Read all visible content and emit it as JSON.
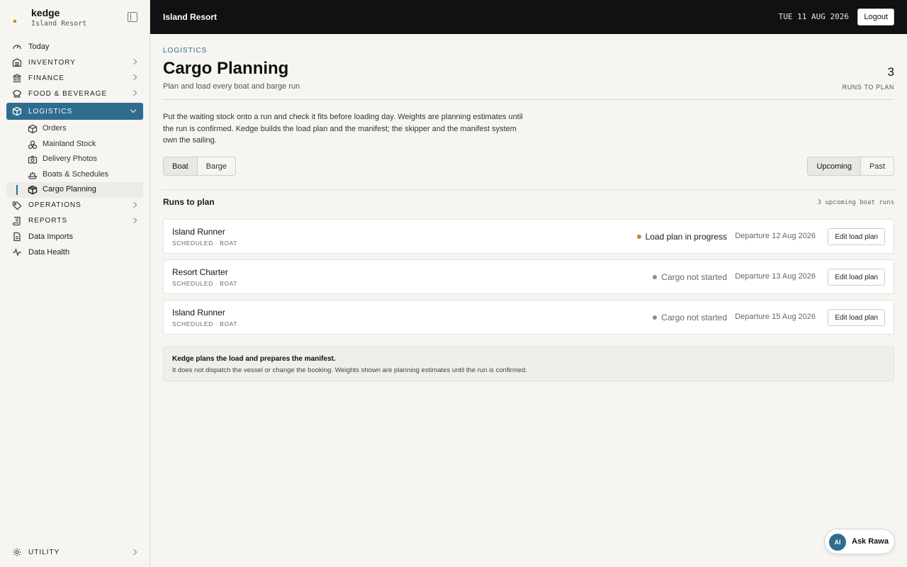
{
  "brand": {
    "name": "kedge",
    "property": "Island Resort"
  },
  "sidebar": {
    "items": [
      {
        "label": "Today",
        "icon": "gauge-icon"
      },
      {
        "label": "INVENTORY",
        "icon": "warehouse-icon"
      },
      {
        "label": "FINANCE",
        "icon": "bank-icon"
      },
      {
        "label": "FOOD & BEVERAGE",
        "icon": "chef-hat-icon"
      },
      {
        "label": "LOGISTICS",
        "icon": "package-icon"
      },
      {
        "label": "OPERATIONS",
        "icon": "tag-icon"
      },
      {
        "label": "REPORTS",
        "icon": "scroll-icon"
      },
      {
        "label": "Data Imports",
        "icon": "file-icon"
      },
      {
        "label": "Data Health",
        "icon": "pulse-icon"
      }
    ],
    "logistics_sub": [
      {
        "label": "Orders",
        "icon": "box-icon"
      },
      {
        "label": "Mainland Stock",
        "icon": "boxes-icon"
      },
      {
        "label": "Delivery Photos",
        "icon": "camera-icon"
      },
      {
        "label": "Boats & Schedules",
        "icon": "ship-icon"
      },
      {
        "label": "Cargo Planning",
        "icon": "cube-icon"
      }
    ],
    "utility": "UTILITY"
  },
  "topbar": {
    "title": "Island Resort",
    "date": "TUE 11 AUG 2026",
    "logout": "Logout"
  },
  "page": {
    "eyebrow": "LOGISTICS",
    "title": "Cargo Planning",
    "subtitle": "Plan and load every boat and barge run",
    "stat_value": "3",
    "stat_label": "RUNS TO PLAN",
    "intro": "Put the waiting stock onto a run and check it fits before loading day. Weights are planning estimates until the run is confirmed. Kedge builds the load plan and the manifest; the skipper and the manifest system own the sailing."
  },
  "vessel_tabs": {
    "boat": "Boat",
    "barge": "Barge",
    "selected": "Boat"
  },
  "time_tabs": {
    "upcoming": "Upcoming",
    "past": "Past",
    "selected": "Upcoming"
  },
  "runs_section": {
    "title": "Runs to plan",
    "note": "3 upcoming boat runs"
  },
  "runs": [
    {
      "name": "Island Runner",
      "meta": "SCHEDULED · BOAT",
      "status": "Load plan in progress",
      "status_color": "#b8862a",
      "status_text_color": "#1b1b1b",
      "departure": "Departure 12 Aug 2026",
      "action": "Edit load plan"
    },
    {
      "name": "Resort Charter",
      "meta": "SCHEDULED · BOAT",
      "status": "Cargo not started",
      "status_color": "#8a8a8a",
      "status_text_color": "#666666",
      "departure": "Departure 13 Aug 2026",
      "action": "Edit load plan"
    },
    {
      "name": "Island Runner",
      "meta": "SCHEDULED · BOAT",
      "status": "Cargo not started",
      "status_color": "#8a8a8a",
      "status_text_color": "#666666",
      "departure": "Departure 15 Aug 2026",
      "action": "Edit load plan"
    }
  ],
  "notice": {
    "title": "Kedge plans the load and prepares the manifest.",
    "detail": "It does not dispatch the vessel or change the booking. Weights shown are planning estimates until the run is confirmed."
  },
  "assistant": {
    "avatar": "AI",
    "label": "Ask Rawa"
  },
  "colors": {
    "accent": "#2e6d8e",
    "topbar": "#0f1113",
    "in_progress": "#b8862a",
    "not_started": "#8a8a8a"
  }
}
